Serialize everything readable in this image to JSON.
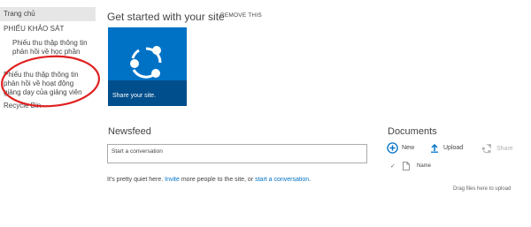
{
  "nav": {
    "home": "Trang chủ",
    "survey": "PHIẾU KHẢO SÁT",
    "survey_items": [
      "Phiếu thu thập thông tin phản hồi về học phần",
      "Phiếu thu thập thông tin phản hồi về hoạt động giảng dạy của giảng viên"
    ],
    "recycle": "Recycle Bin"
  },
  "get_started": {
    "title": "Get started with your site",
    "remove": "REMOVE THIS",
    "tile_label": "Share your site."
  },
  "newsfeed": {
    "title": "Newsfeed",
    "placeholder": "Start a conversation",
    "quiet_prefix": "It's pretty quiet here. ",
    "invite_link": "Invite",
    "quiet_middle": " more people to the site, or ",
    "start_link": "start a conversation",
    "quiet_suffix": "."
  },
  "documents": {
    "title": "Documents",
    "new_label": "New",
    "upload_label": "Upload",
    "share_label": "Share",
    "column_name": "Name",
    "drag_hint": "Drag files here to upload"
  },
  "colors": {
    "accent": "#0072c6",
    "tile_band": "#004e8c",
    "annotation": "#e02020",
    "nav_highlight": "#e6e6e6"
  },
  "icons": [
    "share-icon",
    "plus-circle-icon",
    "upload-icon",
    "share-disabled-icon",
    "checkmark-icon",
    "file-icon"
  ]
}
